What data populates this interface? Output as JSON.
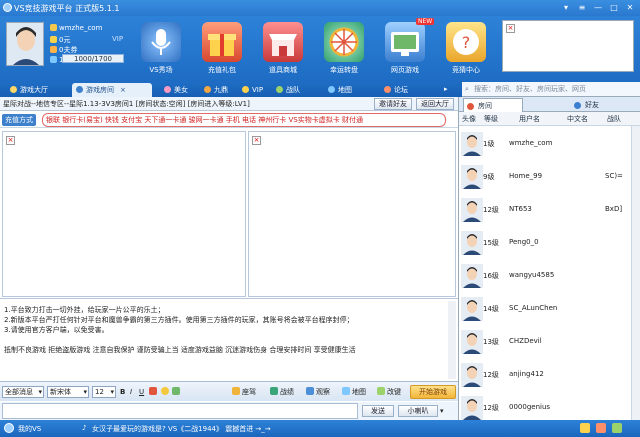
{
  "window": {
    "title": "VS竞技游戏平台 正式版5.1.1"
  },
  "user": {
    "name": "wmzhe_com",
    "coins": "0元",
    "coins_suffix": "VIP",
    "beans": "0夫券",
    "level_prefix": "1级",
    "exp": "1000/1700"
  },
  "nav": [
    {
      "label": "VS秀场",
      "color": "#3b7fd0"
    },
    {
      "label": "充值礼包",
      "color": "#e0553b"
    },
    {
      "label": "道具商城",
      "color": "#d84a3a"
    },
    {
      "label": "幸运转盘",
      "color": "#3ba57a"
    },
    {
      "label": "网页游戏",
      "color": "#4c8fd8",
      "badge": "NEW"
    },
    {
      "label": "竞猜中心",
      "color": "#f0b43a"
    }
  ],
  "tabs": [
    "游戏大厅",
    "游戏房间",
    "美女",
    "九鼎",
    "VIP",
    "战队",
    "地图",
    "论坛"
  ],
  "search": {
    "placeholder": "搜索：房间、好友、房间玩家、网页"
  },
  "room": {
    "info": "星际对战--地信专区--星际1.13-3V3房间1  [房间状态:空闲] [房间进入等级:LV1]",
    "invite_label": "邀请好友",
    "leave_label": "返回大厅"
  },
  "recharge": {
    "label": "充值方式",
    "links": "银联 银行卡(易宝) 快钱 支付宝 天下通一卡通 骏网一卡通 手机 电话 神州行卡 VS实物卡虚拟卡 财付通"
  },
  "notices": [
    "1.平台致力打击一切外挂，给玩家一片公平的乐土；",
    "2.新版本平台严打任何针对平台和魔兽争霸的第三方插件。使用第三方插件的玩家，其账号将会被平台程序封停；",
    "3.请使用官方客户端，以免受害。"
  ],
  "slogan": "抵制不良游戏  拒绝盗版游戏  注意自我保护  谨防受骗上当  适度游戏益脑  沉迷游戏伤身  合理安排时间  享受健康生活",
  "toolbar": {
    "msg_type": "全部消息",
    "font": "新宋体",
    "size": "12",
    "items": [
      "座驾",
      "战绩",
      "观察",
      "地图",
      "改键"
    ],
    "start": "开始游戏"
  },
  "send": {
    "send_label": "发送",
    "whisper_label": "小喇叭"
  },
  "rtabs": [
    "房间",
    "好友"
  ],
  "cols": [
    "头像",
    "等级",
    "用户名",
    "中文名",
    "战队"
  ],
  "players": [
    {
      "lv": "1级",
      "name": "wmzhe_com",
      "extra": ""
    },
    {
      "lv": "9级",
      "name": "Home_99",
      "extra": "SC)="
    },
    {
      "lv": "12级",
      "name": "NT653",
      "extra": "BxD]"
    },
    {
      "lv": "15级",
      "name": "Peng0_0",
      "extra": ""
    },
    {
      "lv": "16级",
      "name": "wangyu4585",
      "extra": ""
    },
    {
      "lv": "14级",
      "name": "SC_ALunChen",
      "extra": ""
    },
    {
      "lv": "13级",
      "name": "CHZDevil",
      "extra": ""
    },
    {
      "lv": "12级",
      "name": "anjing412",
      "extra": ""
    },
    {
      "lv": "12级",
      "name": "0000genius",
      "extra": ""
    }
  ],
  "status": {
    "left": "我的VS",
    "marquee": "女汉子最爱玩的游戏是?  VS《二战1944》 震撼首进 →_→"
  },
  "colors": {
    "accent": "#2a78d0",
    "link_red": "#d02020"
  }
}
